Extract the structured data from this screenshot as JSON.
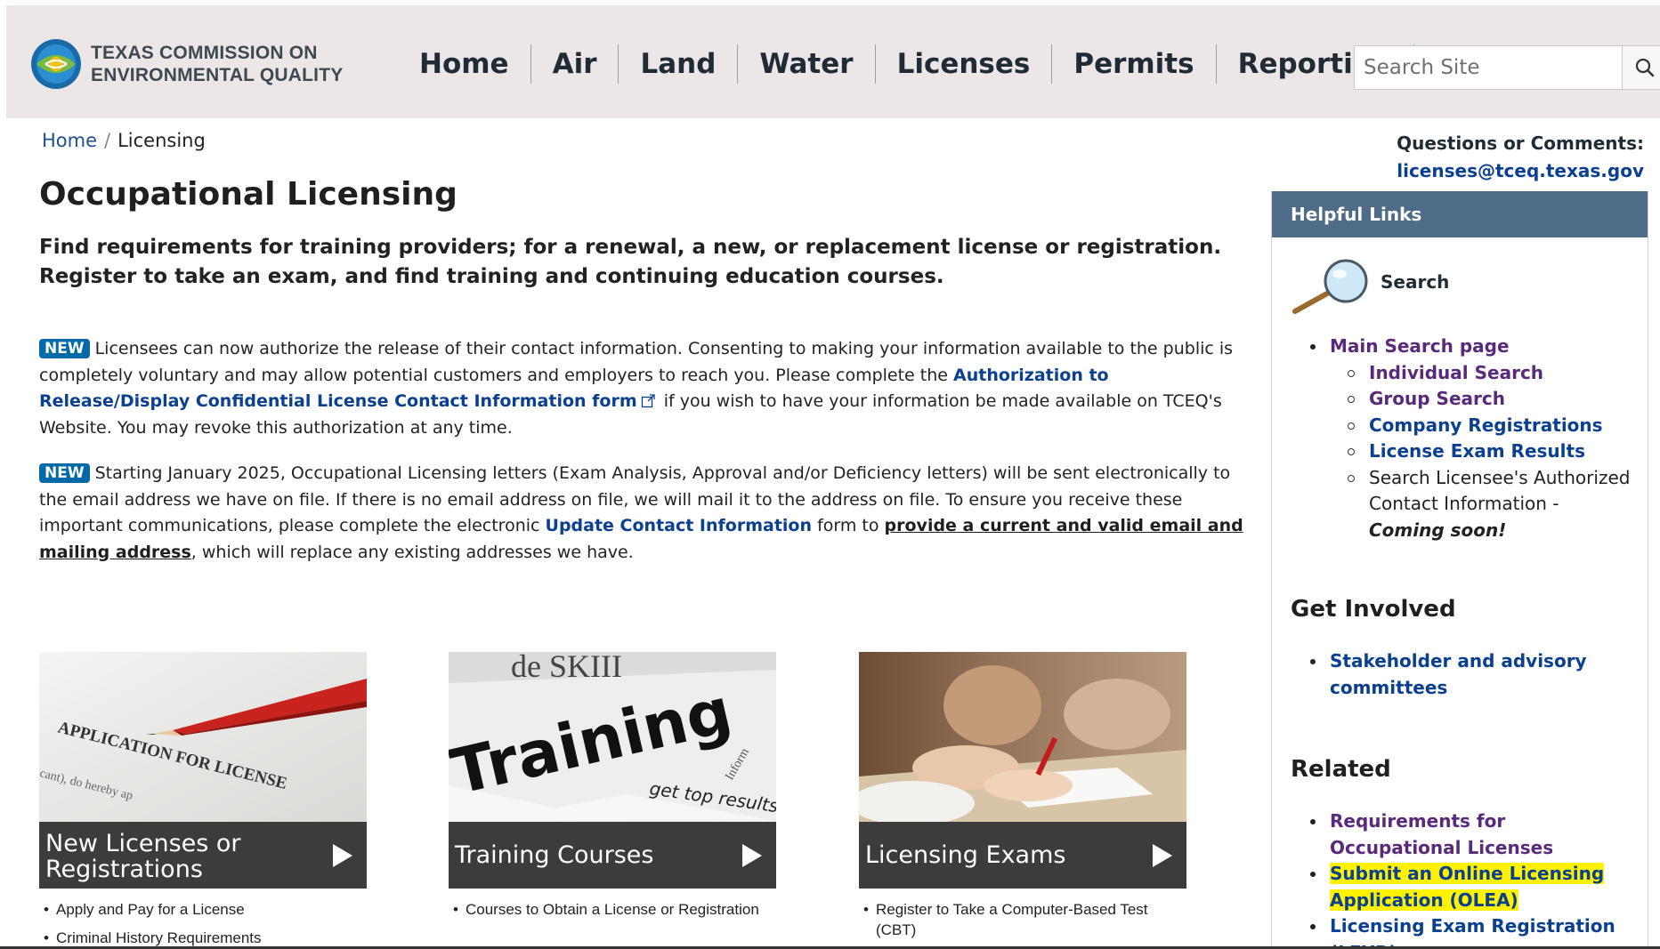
{
  "header": {
    "logo_line1": "TEXAS COMMISSION ON",
    "logo_line2": "ENVIRONMENTAL QUALITY",
    "nav": [
      "Home",
      "Air",
      "Land",
      "Water",
      "Licenses",
      "Permits",
      "Reporting"
    ],
    "search_placeholder": "Search Site"
  },
  "breadcrumb": {
    "home": "Home",
    "sep": "/",
    "current": "Licensing"
  },
  "contact": {
    "label": "Questions or Comments:",
    "email": "licenses@tceq.texas.gov"
  },
  "main": {
    "title": "Occupational Licensing",
    "lead": "Find requirements for training providers; for a renewal, a new, or replacement license or registration. Register to take an exam, and find training and continuing education courses.",
    "notice1": {
      "badge": "NEW",
      "text_before": "Licensees can now authorize the release of their contact information. Consenting to making your information available to the public is completely voluntary and may allow potential customers and employers to reach you. Please complete the ",
      "link": "Authorization to Release/Display Confidential License Contact Information form",
      "text_after": " if you wish to have your information be made available on TCEQ's Website.  You may revoke this authorization at any time."
    },
    "notice2": {
      "badge": "NEW",
      "text_before": "Starting January 2025, Occupational Licensing letters (Exam Analysis, Approval and/or Deficiency letters) will be sent electronically to the email address we have on file. If there is no email address on file, we will mail it to the address on file. To ensure you receive these important communications, please complete the electronic ",
      "link1": "Update Contact Information",
      "text_mid": " form to ",
      "link2": "provide a current and valid email and mailing address",
      "text_after": ", which will replace any existing addresses we have."
    }
  },
  "cards": [
    {
      "title": "New Licenses or Registrations",
      "image_text": "APPLICATION FOR LICENSE",
      "image_subtext": "cant), do hereby ap",
      "items": [
        "Apply and Pay for a License",
        "Criminal History Requirements"
      ]
    },
    {
      "title": "Training Courses",
      "image_text": "Training",
      "image_top": "de SKIII",
      "image_sub": "get top results",
      "image_side": "Inform",
      "items": [
        "Courses to Obtain a License or Registration"
      ]
    },
    {
      "title": "Licensing Exams",
      "items": [
        "Register to Take a Computer-Based Test (CBT)"
      ]
    }
  ],
  "sidebar": {
    "heading": "Helpful Links",
    "search_label": "Search",
    "main_search": "Main Search page",
    "sub": [
      "Individual Search",
      "Group Search",
      "Company Registrations",
      "License Exam Results"
    ],
    "sub_plain": "Search Licensee's Authorized Contact Information -",
    "coming_soon": "Coming soon!",
    "get_involved": "Get Involved",
    "stakeholder": "Stakeholder and advisory committees",
    "related": "Related",
    "related_items": [
      "Requirements for Occupational Licenses",
      "Submit an Online Licensing Application (OLEA)",
      "Licensing Exam Registration (LEXR)"
    ]
  },
  "colors": {
    "header_bg": "#ede6e6",
    "sidebar_head_bg": "#4e6b88",
    "badge_bg": "#0069a8",
    "link_blue": "#0b3f8f",
    "link_purple": "#5a2a7a",
    "highlight": "#fff200",
    "card_bar": "#3c3c3c"
  },
  "icons": [
    "tceq-logo",
    "search-icon",
    "external-link-icon",
    "magnifier-icon",
    "play-arrow-icon"
  ]
}
